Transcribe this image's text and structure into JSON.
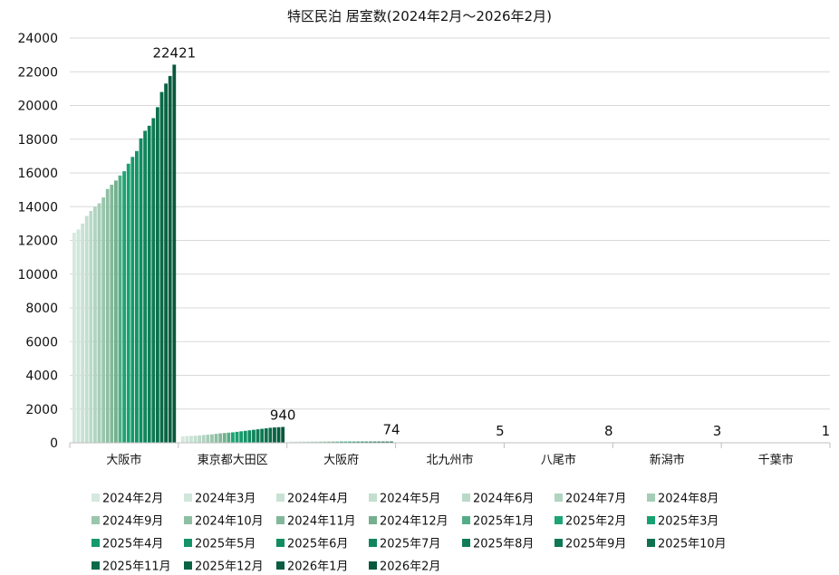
{
  "chart_data": {
    "type": "bar",
    "title": "特区民泊 居室数(2024年2月～2026年2月)",
    "categories": [
      "大阪市",
      "東京都大田区",
      "大阪府",
      "北九州市",
      "八尾市",
      "新潟市",
      "千葉市"
    ],
    "y_ticks": [
      "0",
      "2000",
      "4000",
      "6000",
      "8000",
      "10000",
      "12000",
      "14000",
      "16000",
      "18000",
      "20000",
      "22000",
      "24000"
    ],
    "ylim": [
      0,
      24000
    ],
    "grid": true,
    "legend_position": "bottom",
    "series": [
      {
        "name": "2024年2月",
        "color": "#d6e9df",
        "values": [
          12450,
          390,
          74,
          5,
          8,
          3,
          1
        ]
      },
      {
        "name": "2024年3月",
        "color": "#d0e6db",
        "values": [
          12650,
          400,
          74,
          5,
          8,
          3,
          1
        ]
      },
      {
        "name": "2024年4月",
        "color": "#c9e2d5",
        "values": [
          13000,
          410,
          74,
          5,
          8,
          3,
          1
        ]
      },
      {
        "name": "2024年5月",
        "color": "#c2dfcf",
        "values": [
          13450,
          420,
          74,
          5,
          8,
          3,
          1
        ]
      },
      {
        "name": "2024年6月",
        "color": "#bad9c8",
        "values": [
          13750,
          440,
          74,
          5,
          8,
          3,
          1
        ]
      },
      {
        "name": "2024年7月",
        "color": "#b1d4c1",
        "values": [
          14000,
          460,
          74,
          5,
          8,
          3,
          1
        ]
      },
      {
        "name": "2024年8月",
        "color": "#a6cdb7",
        "values": [
          14200,
          480,
          74,
          5,
          8,
          3,
          1
        ]
      },
      {
        "name": "2024年9月",
        "color": "#9ac6ad",
        "values": [
          14550,
          500,
          74,
          5,
          8,
          3,
          1
        ]
      },
      {
        "name": "2024年10月",
        "color": "#8ebfa3",
        "values": [
          15050,
          530,
          74,
          5,
          8,
          3,
          1
        ]
      },
      {
        "name": "2024年11月",
        "color": "#82b899",
        "values": [
          15300,
          560,
          74,
          5,
          8,
          3,
          1
        ]
      },
      {
        "name": "2024年12月",
        "color": "#74b08e",
        "values": [
          15550,
          580,
          74,
          5,
          8,
          3,
          1
        ]
      },
      {
        "name": "2025年1月",
        "color": "#55ad86",
        "values": [
          15850,
          600,
          74,
          5,
          8,
          3,
          1
        ]
      },
      {
        "name": "2025年2月",
        "color": "#1ba673",
        "values": [
          16100,
          620,
          74,
          5,
          8,
          3,
          1
        ]
      },
      {
        "name": "2025年3月",
        "color": "#18a170",
        "values": [
          16550,
          650,
          74,
          5,
          8,
          3,
          1
        ]
      },
      {
        "name": "2025年4月",
        "color": "#159a6b",
        "values": [
          16950,
          680,
          74,
          5,
          8,
          3,
          1
        ]
      },
      {
        "name": "2025年5月",
        "color": "#139366",
        "values": [
          17300,
          710,
          74,
          5,
          8,
          3,
          1
        ]
      },
      {
        "name": "2025年6月",
        "color": "#118c61",
        "values": [
          18050,
          740,
          74,
          5,
          8,
          3,
          1
        ]
      },
      {
        "name": "2025年7月",
        "color": "#10855c",
        "values": [
          18500,
          770,
          74,
          5,
          8,
          3,
          1
        ]
      },
      {
        "name": "2025年8月",
        "color": "#0f7e57",
        "values": [
          18800,
          800,
          74,
          5,
          8,
          3,
          1
        ]
      },
      {
        "name": "2025年9月",
        "color": "#0e7852",
        "values": [
          19250,
          830,
          74,
          5,
          8,
          3,
          1
        ]
      },
      {
        "name": "2025年10月",
        "color": "#0c714d",
        "values": [
          19900,
          860,
          74,
          5,
          8,
          3,
          1
        ]
      },
      {
        "name": "2025年11月",
        "color": "#0b6a48",
        "values": [
          20800,
          890,
          74,
          5,
          8,
          3,
          1
        ]
      },
      {
        "name": "2025年12月",
        "color": "#0a6444",
        "values": [
          21300,
          910,
          74,
          5,
          8,
          3,
          1
        ]
      },
      {
        "name": "2026年1月",
        "color": "#095e40",
        "values": [
          21750,
          925,
          74,
          5,
          8,
          3,
          1
        ]
      },
      {
        "name": "2026年2月",
        "color": "#08583c",
        "values": [
          22421,
          940,
          74,
          5,
          8,
          3,
          1
        ]
      }
    ],
    "data_labels": [
      {
        "category": "大阪市",
        "text": "22421",
        "color": "#e8202a"
      },
      {
        "category": "東京都大田区",
        "text": "940",
        "color": "#111111"
      },
      {
        "category": "大阪府",
        "text": "74",
        "color": "#111111"
      },
      {
        "category": "北九州市",
        "text": "5",
        "color": "#111111"
      },
      {
        "category": "八尾市",
        "text": "8",
        "color": "#111111"
      },
      {
        "category": "新潟市",
        "text": "3",
        "color": "#111111"
      },
      {
        "category": "千葉市",
        "text": "1",
        "color": "#111111"
      }
    ]
  }
}
